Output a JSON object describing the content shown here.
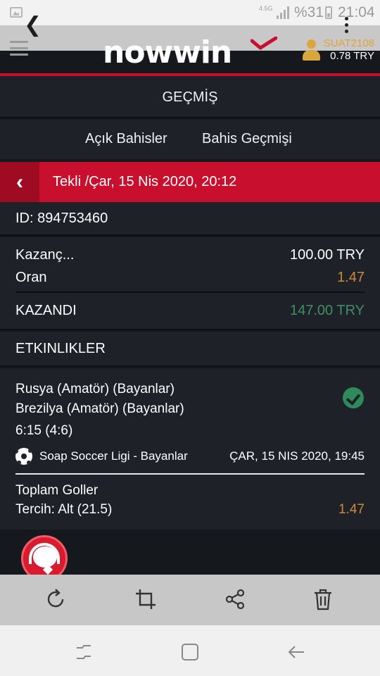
{
  "status_bar": {
    "network_type": "4.5G",
    "battery": "%31",
    "time": "21:04"
  },
  "header": {
    "logo_text": "nowwin",
    "username": "SUAT2108",
    "balance": "0.78 TRY"
  },
  "page_title": "GEÇMİŞ",
  "tabs": [
    {
      "label": "Açık Bahisler"
    },
    {
      "label": "Bahis Geçmişi"
    }
  ],
  "ticket": {
    "header": "Tekli /Çar, 15 Nis 2020, 20:12",
    "id": "ID: 894753460",
    "stake_label": "Kazanç...",
    "stake_value": "100.00 TRY",
    "odds_label": "Oran",
    "odds_value": "1.47",
    "result_label": "KAZANDI",
    "result_value": "147.00 TRY"
  },
  "events_section": {
    "title": "ETKINLIKLER",
    "event": {
      "home": "Rusya (Amatör) (Bayanlar)",
      "away": "Brezilya (Amatör) (Bayanlar)",
      "score": "6:15 (4:6)",
      "league": "Soap Soccer Ligi - Bayanlar",
      "datetime": "ÇAR, 15 NIS 2020, 19:45",
      "market": "Toplam Goller",
      "selection": "Tercih: Alt (21.5)",
      "odds": "1.47"
    }
  },
  "colors": {
    "brand_red": "#c8102e",
    "win_green": "#3e8f63",
    "odds_orange": "#c98b3a"
  }
}
